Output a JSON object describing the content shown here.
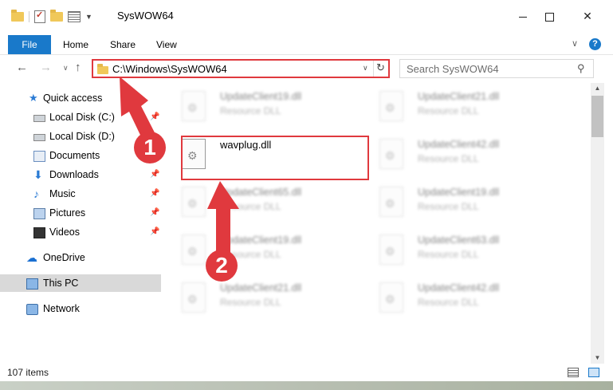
{
  "window": {
    "title": "SysWOW64"
  },
  "ribbon": {
    "file": "File",
    "home": "Home",
    "share": "Share",
    "view": "View"
  },
  "address": {
    "path": "C:\\Windows\\SysWOW64"
  },
  "search": {
    "placeholder": "Search SysWOW64"
  },
  "sidebar": {
    "quick_access": "Quick access",
    "items": [
      {
        "label": "Local Disk (C:)",
        "icon": "drive-icon"
      },
      {
        "label": "Local Disk (D:)",
        "icon": "drive-icon"
      },
      {
        "label": "Documents",
        "icon": "documents-icon"
      },
      {
        "label": "Downloads",
        "icon": "downloads-icon"
      },
      {
        "label": "Music",
        "icon": "music-icon"
      },
      {
        "label": "Pictures",
        "icon": "pictures-icon"
      },
      {
        "label": "Videos",
        "icon": "videos-icon"
      }
    ],
    "onedrive": "OneDrive",
    "this_pc": "This PC",
    "network": "Network"
  },
  "files": [
    {
      "name": "UpdateClient19.dll",
      "type": "Resource DLL"
    },
    {
      "name": "UpdateClient21.dll",
      "type": "Resource DLL"
    },
    {
      "name": "wavplug.dll",
      "type": ""
    },
    {
      "name": "UpdateClient42.dll",
      "type": "Resource DLL"
    },
    {
      "name": "UpdateClient65.dll",
      "type": "Resource DLL"
    },
    {
      "name": "UpdateClient19.dll",
      "type": "Resource DLL"
    },
    {
      "name": "UpdateClient19.dll",
      "type": "Resource DLL"
    },
    {
      "name": "UpdateClient63.dll",
      "type": "Resource DLL"
    },
    {
      "name": "UpdateClient21.dll",
      "type": "Resource DLL"
    },
    {
      "name": "UpdateClient42.dll",
      "type": "Resource DLL"
    }
  ],
  "status": {
    "count": "107 items"
  },
  "annotations": {
    "step1": "1",
    "step2": "2"
  },
  "colors": {
    "accent": "#1979ca",
    "highlight": "#e0393e"
  }
}
